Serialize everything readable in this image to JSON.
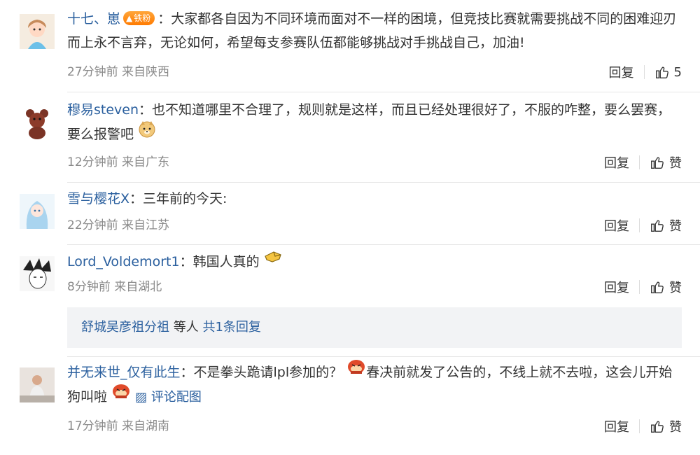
{
  "comments": [
    {
      "username": "十七、崽",
      "badge": "铁粉",
      "separator": "：",
      "text": "大家都各自因为不同环境而面对不一样的困境，但竞技比赛就需要挑战不同的困难迎刃而上永不言弃，无论如何，希望每支参赛队伍都能够挑战对手挑战自己，加油!",
      "time": "27分钟前",
      "location": "来自陕西",
      "reply_label": "回复",
      "like_count": "5"
    },
    {
      "username": "穆易steven",
      "separator": "：",
      "text": "也不知道哪里不合理了，规则就是这样，而且已经处理很好了，不服的咋整，要么罢赛，要么报警吧",
      "emoji_icon": "doge-emoji-icon",
      "time": "12分钟前",
      "location": "来自广东",
      "reply_label": "回复",
      "like_label": "赞"
    },
    {
      "username": "雪与樱花X",
      "separator": "：",
      "text": "三年前的今天:",
      "time": "22分钟前",
      "location": "来自江苏",
      "reply_label": "回复",
      "like_label": "赞"
    },
    {
      "username": "Lord_Voldemort1",
      "separator": "：",
      "text": "韩国人真的",
      "emoji_icon": "point-emoji-icon",
      "time": "8分钟前",
      "location": "来自湖北",
      "reply_label": "回复",
      "like_label": "赞",
      "sub_reply": {
        "user": "舒城吴彦祖分祖",
        "middle": " 等人 ",
        "count_link": "共1条回复"
      }
    },
    {
      "username": "并无来世_仅有此生",
      "separator": "：",
      "text_part1": "不是拳头跪请lpl参加的？",
      "text_part2": "春决前就发了公告的，不线上就不去啦，这会儿开始狗叫啦",
      "emoji_icon": "angry-emoji-icon",
      "pic_link": "评论配图",
      "time": "17分钟前",
      "location": "来自湖南",
      "reply_label": "回复",
      "like_label": "赞"
    }
  ],
  "colors": {
    "username": "#2a5f9e",
    "meta": "#8a8a8a",
    "badge": "#ff8a00"
  }
}
